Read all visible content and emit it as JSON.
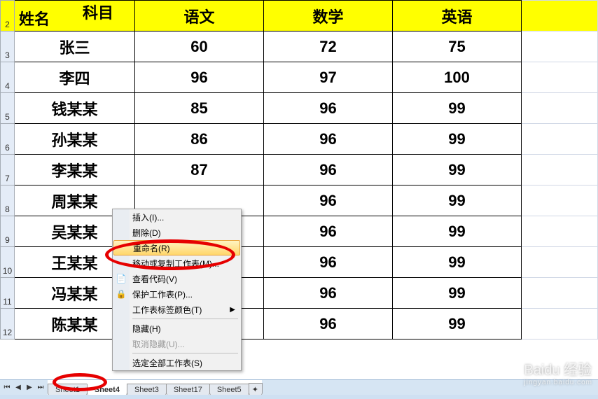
{
  "header": {
    "diag_top": "科目",
    "diag_bot": "姓名",
    "col_b": "语文",
    "col_c": "数学",
    "col_d": "英语"
  },
  "row_numbers": [
    "2",
    "3",
    "4",
    "5",
    "6",
    "7",
    "8",
    "9",
    "10",
    "11",
    "12"
  ],
  "rows": [
    {
      "name": "张三",
      "b": "60",
      "c": "72",
      "d": "75"
    },
    {
      "name": "李四",
      "b": "96",
      "c": "97",
      "d": "100"
    },
    {
      "name": "钱某某",
      "b": "85",
      "c": "96",
      "d": "99"
    },
    {
      "name": "孙某某",
      "b": "86",
      "c": "96",
      "d": "99"
    },
    {
      "name": "李某某",
      "b": "87",
      "c": "96",
      "d": "99"
    },
    {
      "name": "周某某",
      "b": "",
      "c": "96",
      "d": "99"
    },
    {
      "name": "吴某某",
      "b": "",
      "c": "96",
      "d": "99"
    },
    {
      "name": "王某某",
      "b": "",
      "c": "96",
      "d": "99"
    },
    {
      "name": "冯某某",
      "b": "",
      "c": "96",
      "d": "99"
    },
    {
      "name": "陈某某",
      "b": "",
      "c": "96",
      "d": "99"
    }
  ],
  "context_menu": {
    "insert": "插入(I)...",
    "delete": "删除(D)",
    "rename": "重命名(R)",
    "move_copy": "移动或复制工作表(M)...",
    "view_code": "查看代码(V)",
    "protect": "保护工作表(P)...",
    "tab_color": "工作表标签颜色(T)",
    "hide": "隐藏(H)",
    "unhide": "取消隐藏(U)...",
    "select_all": "选定全部工作表(S)"
  },
  "tabs": {
    "t1": "Sheet1",
    "t2": "Sheet4",
    "t3": "Sheet3",
    "t4": "Sheet17",
    "t5": "Sheet5"
  },
  "watermark": {
    "brand": "Baidu 经验",
    "url": "jingyan.baidu.com"
  }
}
